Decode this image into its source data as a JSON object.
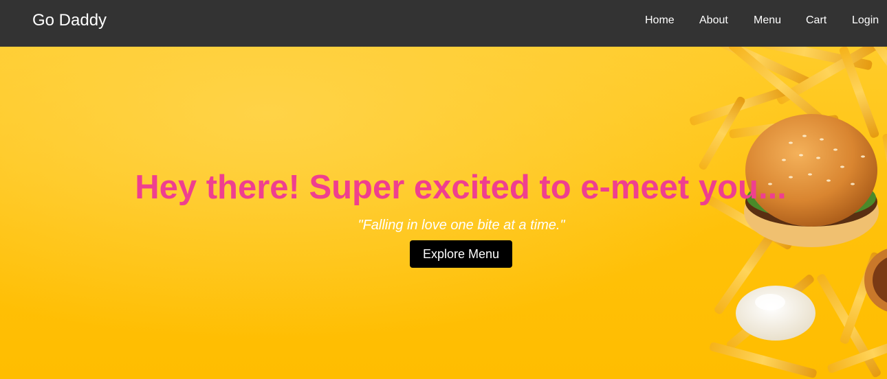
{
  "navbar": {
    "brand": "Go Daddy",
    "links": [
      {
        "label": "Home"
      },
      {
        "label": "About"
      },
      {
        "label": "Menu"
      },
      {
        "label": "Cart"
      },
      {
        "label": "Login"
      }
    ]
  },
  "hero": {
    "title": "Hey there! Super excited to e-meet you...",
    "tagline": "\"Falling in love one bite at a time.\"",
    "cta_label": "Explore Menu",
    "background_image": "burger-and-fries-image"
  },
  "colors": {
    "navbar_bg": "#333333",
    "hero_bg": "#ffc20e",
    "title": "#ef3f8f",
    "button_bg": "#000000"
  }
}
